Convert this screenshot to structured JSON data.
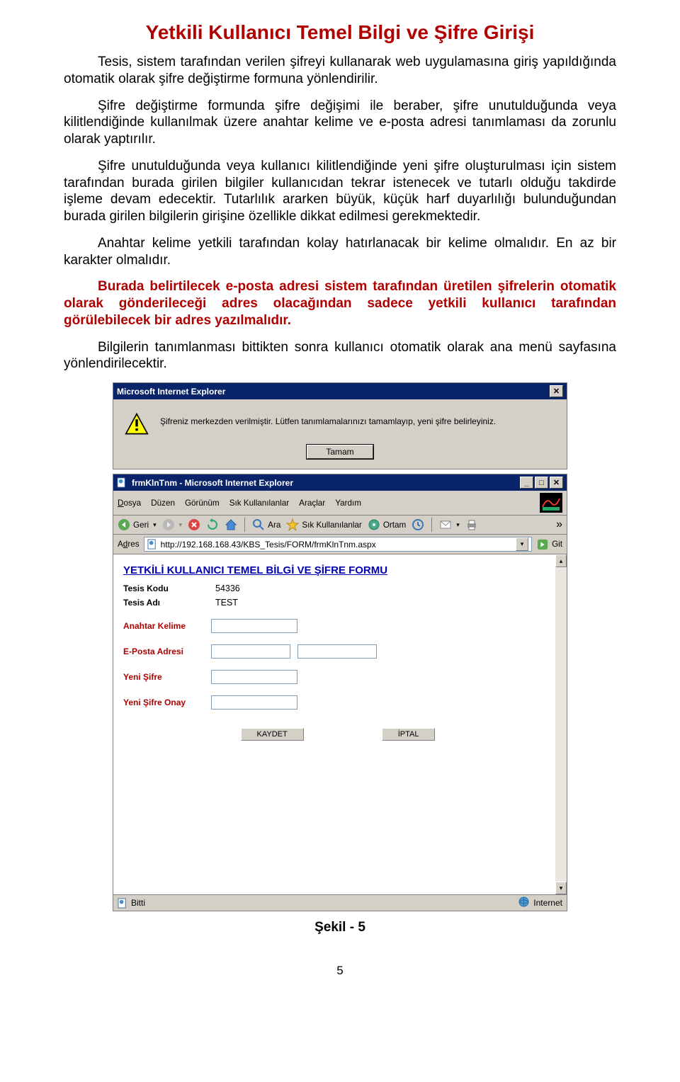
{
  "title": "Yetkili Kullanıcı Temel Bilgi ve Şifre Girişi",
  "paragraphs": {
    "p1": "Tesis, sistem tarafından verilen şifreyi kullanarak web uygulamasına giriş yapıldığında otomatik olarak şifre değiştirme formuna yönlendirilir.",
    "p2": "Şifre değiştirme formunda şifre değişimi ile beraber, şifre unutulduğunda veya kilitlendiğinde kullanılmak üzere anahtar kelime ve e-posta adresi tanımlaması da zorunlu olarak yaptırılır.",
    "p3": "Şifre unutulduğunda veya kullanıcı kilitlendiğinde yeni şifre oluşturulması için sistem tarafından burada girilen bilgiler kullanıcıdan tekrar istenecek ve tutarlı olduğu takdirde işleme devam edecektir. Tutarlılık ararken büyük, küçük harf duyarlılığı bulunduğundan burada girilen bilgilerin girişine özellikle dikkat edilmesi gerekmektedir.",
    "p4": "Anahtar kelime yetkili tarafından kolay hatırlanacak bir kelime olmalıdır. En az bir karakter olmalıdır.",
    "p5": "Burada belirtilecek e-posta adresi sistem tarafından üretilen şifrelerin otomatik olarak gönderileceği adres olacağından sadece yetkili kullanıcı tarafından görülebilecek bir adres yazılmalıdır.",
    "p6": "Bilgilerin tanımlanması bittikten sonra kullanıcı otomatik olarak ana menü sayfasına yönlendirilecektir."
  },
  "alert": {
    "title": "Microsoft Internet Explorer",
    "message": "Şifreniz merkezden verilmiştir. Lütfen tanımlamalarınızı tamamlayıp, yeni şifre belirleyiniz.",
    "ok": "Tamam"
  },
  "browser": {
    "title": "frmKlnTnm - Microsoft Internet Explorer",
    "menu": {
      "file": "Dosya",
      "edit": "Düzen",
      "view": "Görünüm",
      "fav": "Sık Kullanılanlar",
      "tools": "Araçlar",
      "help": "Yardım"
    },
    "toolbar": {
      "back": "Geri",
      "search": "Ara",
      "fav": "Sık Kullanılanlar",
      "media": "Ortam"
    },
    "address_label": "Adres",
    "address": "http://192.168.168.43/KBS_Tesis/FORM/frmKlnTnm.aspx",
    "go": "Git",
    "status_left": "Bitti",
    "status_right": "Internet"
  },
  "form": {
    "heading": "YETKİLİ KULLANICI TEMEL BİLGİ VE ŞİFRE FORMU",
    "labels": {
      "tesis_kodu": "Tesis Kodu",
      "tesis_adi": "Tesis Adı",
      "anahtar": "Anahtar Kelime",
      "eposta": "E-Posta Adresi",
      "yeni_sifre": "Yeni Şifre",
      "yeni_sifre_onay": "Yeni Şifre Onay"
    },
    "values": {
      "tesis_kodu": "54336",
      "tesis_adi": "TEST"
    },
    "buttons": {
      "save": "KAYDET",
      "cancel": "İPTAL"
    }
  },
  "caption": "Şekil - 5",
  "page_number": "5"
}
